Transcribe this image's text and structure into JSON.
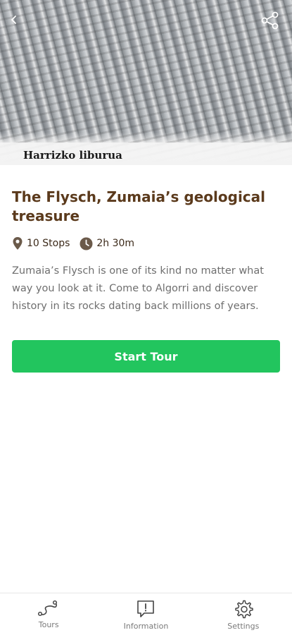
{
  "hero": {
    "caption": "Harrizko liburua",
    "back_icon": "chevron-left-icon",
    "share_icon": "share-icon"
  },
  "tour": {
    "title": "The Flysch, Zumaia’s geological treasure",
    "stops": "10 Stops",
    "duration": "2h 30m",
    "description": "Zumaia’s Flysch is one of its kind no matter what way you look at it. Come to Algorri and discover history in its rocks dating back millions of years.",
    "start_label": "Start Tour"
  },
  "nav": {
    "items": [
      {
        "label": "Tours",
        "icon": "route-icon"
      },
      {
        "label": "Information",
        "icon": "info-bubble-icon"
      },
      {
        "label": "Settings",
        "icon": "gear-icon"
      }
    ]
  },
  "colors": {
    "accent": "#22c55e",
    "title": "#5b3a1c",
    "meta_icon": "#6b5a4a",
    "body_text": "#6f6f6f"
  }
}
